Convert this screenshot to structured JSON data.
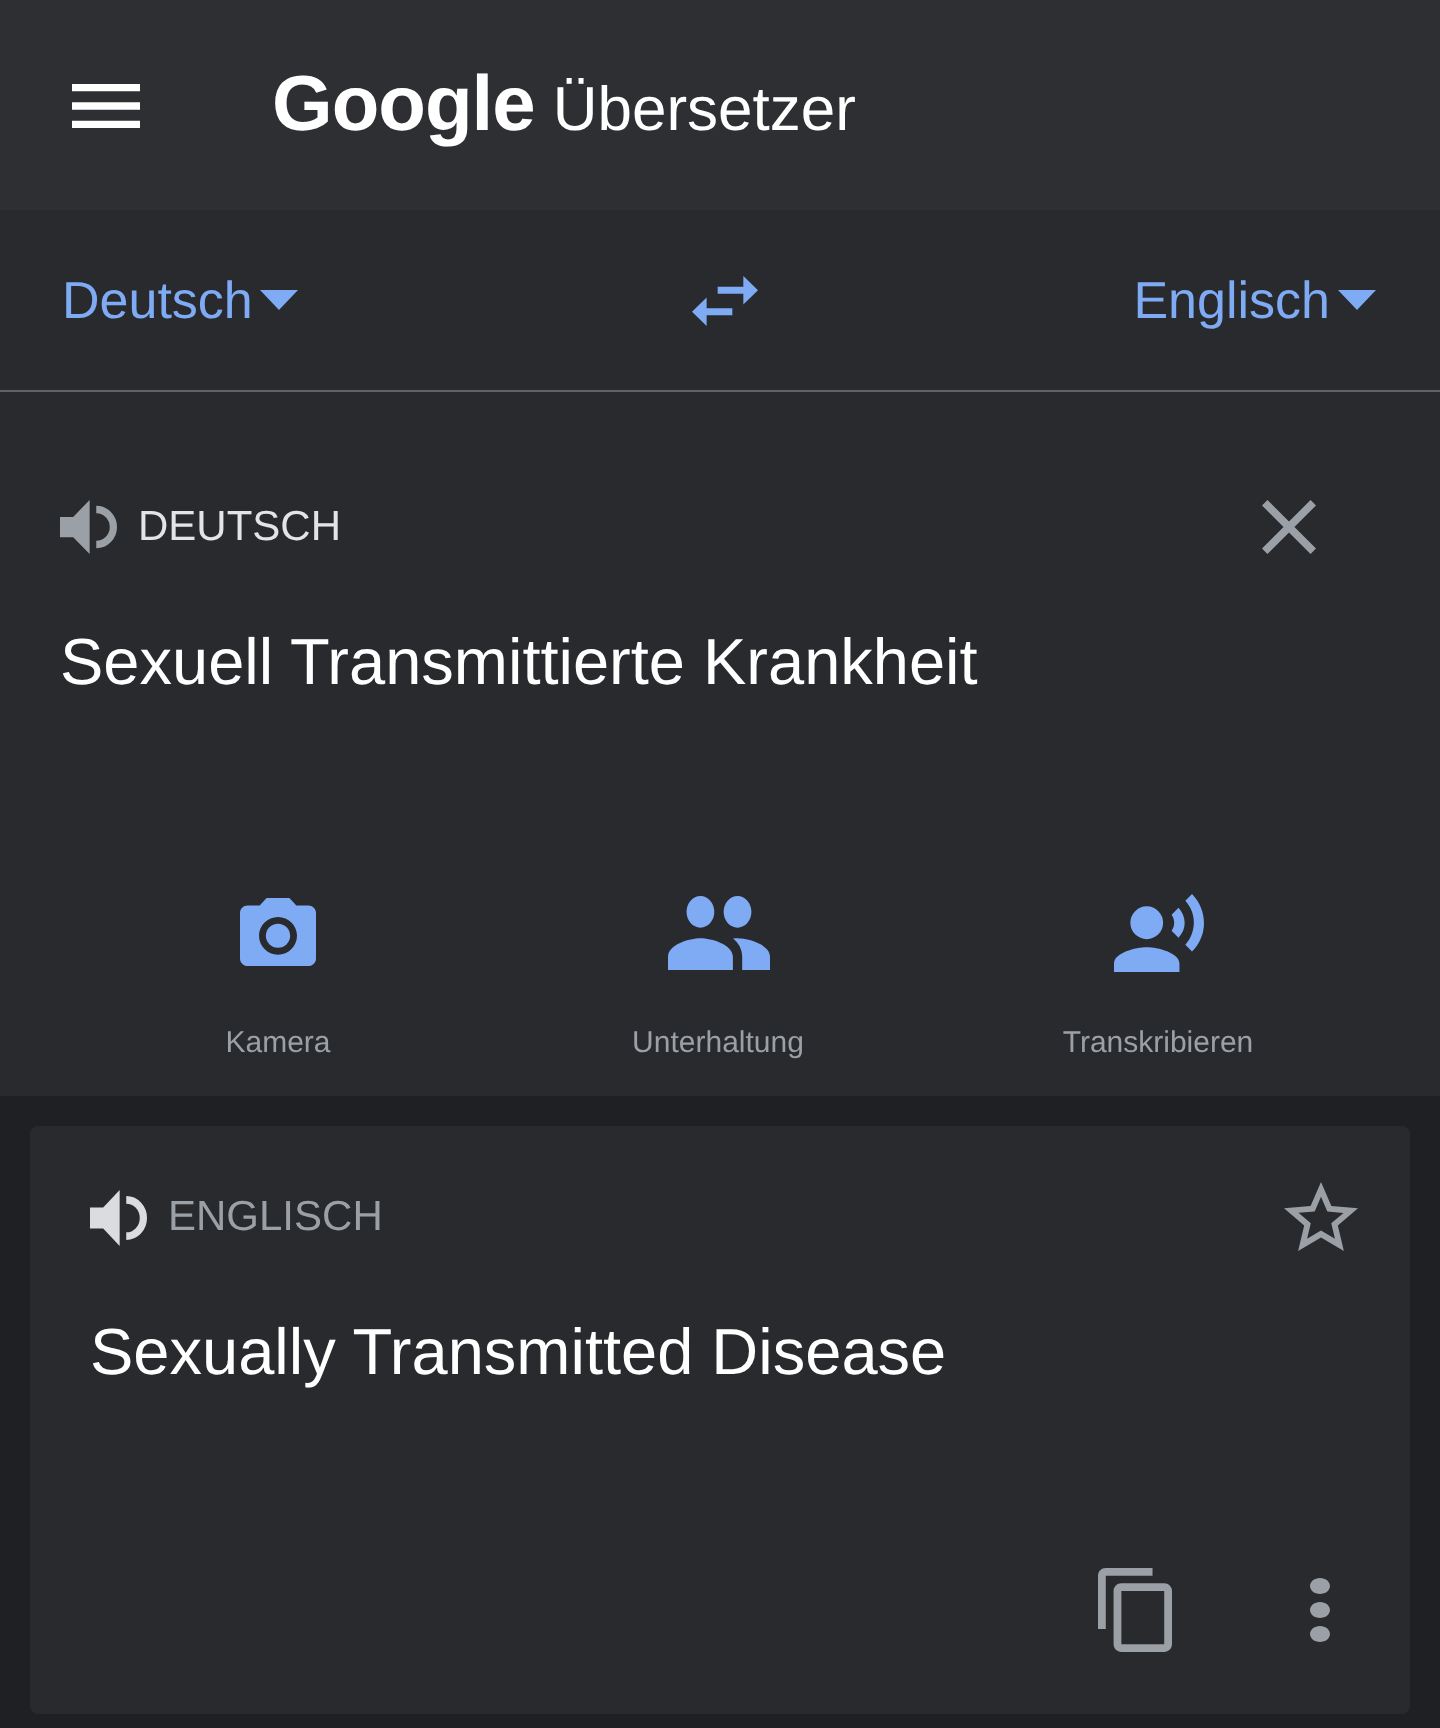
{
  "header": {
    "logo": "Google",
    "title": "Übersetzer"
  },
  "language_bar": {
    "source": "Deutsch",
    "target": "Englisch"
  },
  "input": {
    "language": "DEUTSCH",
    "text": "Sexuell Transmittierte Krankheit",
    "actions": [
      {
        "kind": "camera",
        "label": "Kamera"
      },
      {
        "kind": "conversation",
        "label": "Unterhaltung"
      },
      {
        "kind": "transcribe",
        "label": "Transkribieren"
      }
    ]
  },
  "output": {
    "language": "ENGLISCH",
    "text": "Sexually Transmitted Disease",
    "starred": false
  }
}
